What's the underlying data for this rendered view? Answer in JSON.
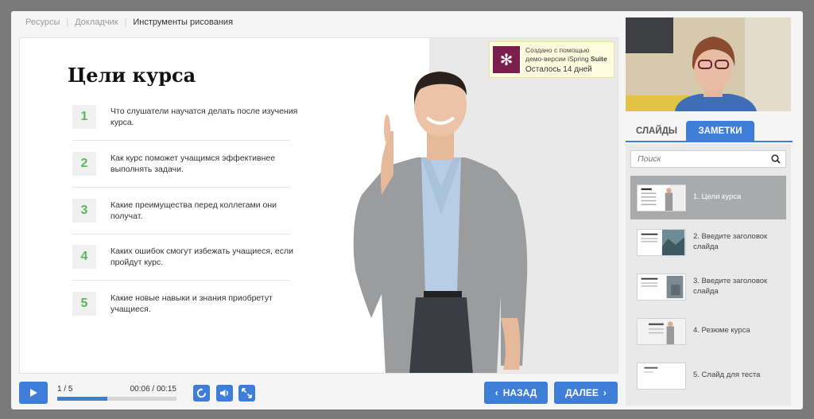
{
  "breadcrumb": [
    "Ресурсы",
    "Докладчик",
    "Инструменты рисования"
  ],
  "slide": {
    "title": "Цели курса",
    "goals": [
      {
        "num": "1",
        "text": "Что слушатели научатся делать после изучения курса."
      },
      {
        "num": "2",
        "text": "Как курс поможет учащимся эффективнее выполнять задачи."
      },
      {
        "num": "3",
        "text": "Какие преимущества перед коллегами они получат."
      },
      {
        "num": "4",
        "text": "Каких ошибок смогут избежать учащиеся, если пройдут курс."
      },
      {
        "num": "5",
        "text": "Какие новые навыки и знания приобретут учащиеся."
      }
    ]
  },
  "badge": {
    "line1": "Создано с помощью",
    "line2_prefix": "демо-версии iSpring ",
    "line2_bold": "Suite",
    "days": "Осталось 14 дней"
  },
  "player": {
    "slide_counter": "1 / 5",
    "time": "00:06 / 00:15",
    "progress": 0.42,
    "back_label": "НАЗАД",
    "next_label": "ДАЛЕЕ"
  },
  "sidebar": {
    "tabs": [
      "СЛАЙДЫ",
      "ЗАМЕТКИ"
    ],
    "search_placeholder": "Поиск",
    "slides": [
      "1. Цели курса",
      "2. Введите заголовок слайда",
      "3. Введите заголовок слайда",
      "4. Резюме курса",
      "5. Слайд для теста"
    ]
  },
  "colors": {
    "accent": "#3f7ed8",
    "number": "#5cb85c",
    "logo": "#7b1e4d"
  }
}
